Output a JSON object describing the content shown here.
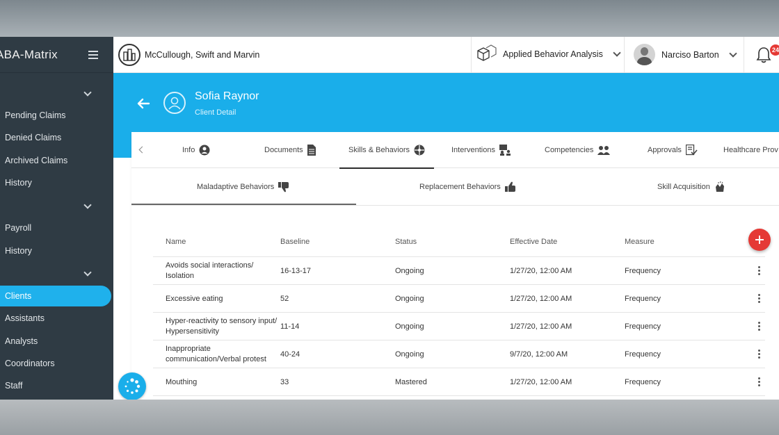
{
  "app": {
    "brand": "ABA-Matrix"
  },
  "sidebar": {
    "items": [
      {
        "label": "Pending Claims"
      },
      {
        "label": "Denied Claims"
      },
      {
        "label": "Archived Claims"
      },
      {
        "label": "History"
      },
      {
        "label": "Payroll"
      },
      {
        "label": "History"
      },
      {
        "label": "Clients",
        "active": true
      },
      {
        "label": "Assistants"
      },
      {
        "label": "Analysts"
      },
      {
        "label": "Coordinators"
      },
      {
        "label": "Staff"
      }
    ]
  },
  "topbar": {
    "organization": "McCullough, Swift and Marvin",
    "practice": "Applied Behavior Analysis",
    "user": "Narciso Barton",
    "notification_count": "24"
  },
  "client": {
    "name": "Sofia Raynor",
    "subtitle": "Client Detail"
  },
  "tabs": [
    {
      "label": "Info",
      "icon": "user-circle-icon"
    },
    {
      "label": "Documents",
      "icon": "document-icon"
    },
    {
      "label": "Skills & Behaviors",
      "icon": "puzzle-icon",
      "active": true
    },
    {
      "label": "Interventions",
      "icon": "presenter-icon"
    },
    {
      "label": "Competencies",
      "icon": "users-icon"
    },
    {
      "label": "Approvals",
      "icon": "check-document-icon"
    },
    {
      "label": "Healthcare Prov"
    }
  ],
  "subtabs": [
    {
      "label": "Maladaptive Behaviors",
      "icon": "thumbs-down-icon",
      "active": true
    },
    {
      "label": "Replacement Behaviors",
      "icon": "thumbs-up-icon"
    },
    {
      "label": "Skill Acquisition",
      "icon": "clap-icon"
    }
  ],
  "table": {
    "columns": [
      "Name",
      "Baseline",
      "Status",
      "Effective Date",
      "Measure"
    ],
    "rows": [
      {
        "name": "Avoids social interactions/ Isolation",
        "baseline": "16-13-17",
        "status": "Ongoing",
        "date": "1/27/20, 12:00 AM",
        "measure": "Frequency"
      },
      {
        "name": "Excessive eating",
        "baseline": "52",
        "status": "Ongoing",
        "date": "1/27/20, 12:00 AM",
        "measure": "Frequency"
      },
      {
        "name": "Hyper-reactivity to sensory input/ Hypersensitivity",
        "baseline": "11-14",
        "status": "Ongoing",
        "date": "1/27/20, 12:00 AM",
        "measure": "Frequency"
      },
      {
        "name": "Inappropriate communication/Verbal protest",
        "baseline": "40-24",
        "status": "Ongoing",
        "date": "9/7/20, 12:00 AM",
        "measure": "Frequency"
      },
      {
        "name": "Mouthing",
        "baseline": "33",
        "status": "Mastered",
        "date": "1/27/20, 12:00 AM",
        "measure": "Frequency"
      }
    ]
  },
  "colors": {
    "accent": "#1aaeea",
    "sidebar": "#2f3b44",
    "danger": "#e53935"
  }
}
